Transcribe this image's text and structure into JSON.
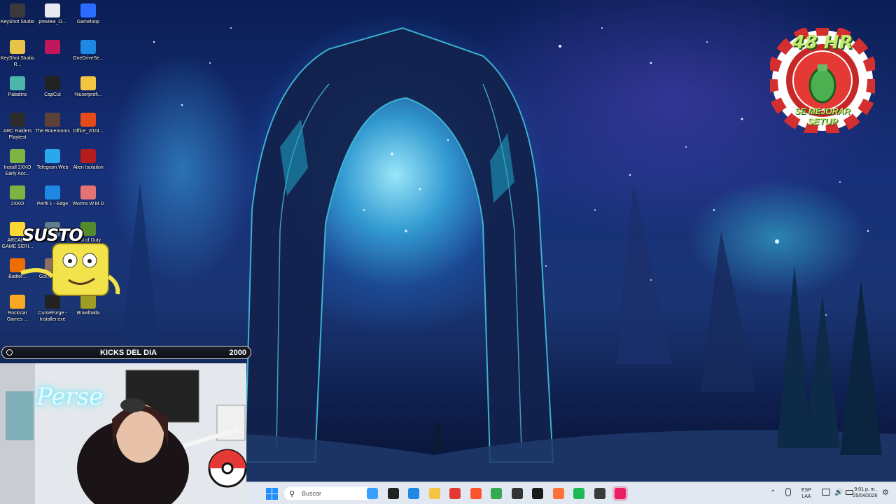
{
  "desktop": {
    "icons": [
      {
        "label": "KeyShot Studio",
        "color": "#3a3a3a"
      },
      {
        "label": "preview_O...",
        "color": "#e8e8f0"
      },
      {
        "label": "Gameloop",
        "color": "#2a6cff"
      },
      {
        "label": "KeyShot Studio R...",
        "color": "#e7c34a"
      },
      {
        "label": "",
        "color": "#c2185b"
      },
      {
        "label": "OneDriveSe...",
        "color": "#1e88e5"
      },
      {
        "label": "Paladins",
        "color": "#4db6ac"
      },
      {
        "label": "CapCut",
        "color": "#222222"
      },
      {
        "label": "%userprofi...",
        "color": "#f4c542"
      },
      {
        "label": "ARC Raiders Playtest",
        "color": "#2b2b2b"
      },
      {
        "label": "The Bonerooms",
        "color": "#5d4037"
      },
      {
        "label": "Office_2024...",
        "color": "#e64a19"
      },
      {
        "label": "Install 2XKO Early Acc...",
        "color": "#7cb342"
      },
      {
        "label": "Telegram Web",
        "color": "#29a9eb"
      },
      {
        "label": "Alien Isolation",
        "color": "#b71c1c"
      },
      {
        "label": "2XKO",
        "color": "#7cb342"
      },
      {
        "label": "Perfil 1 - Edge",
        "color": "#1e88e5"
      },
      {
        "label": "Worms W.M.D",
        "color": "#e57373"
      },
      {
        "label": "ARCADE GAME SERI...",
        "color": "#fdd835"
      },
      {
        "label": "Auto",
        "color": "#607d8b"
      },
      {
        "label": "Call of Duty",
        "color": "#558b2f"
      },
      {
        "label": "Battlef...",
        "color": "#ef6c00"
      },
      {
        "label": "Goi... Your...",
        "color": "#8d6e63"
      },
      {
        "label": "Adobe Illustrat...",
        "color": "#3b1f00"
      },
      {
        "label": "Rockstar Games ...",
        "color": "#f9a825"
      },
      {
        "label": "CurseForge - Installer.exe",
        "color": "#222222"
      },
      {
        "label": "Brawlhalla",
        "color": "#9e9d24"
      }
    ]
  },
  "overlays": {
    "badge_top": "48 HR",
    "badge_bottom_1": "SE MEJORAR",
    "badge_bottom_2": "SETUP",
    "badge_color": "#d32f2f",
    "susto_text": "SUSTO",
    "kicks_label": "KICKS DEL DIA",
    "kicks_count": "2000",
    "webcam_neon_text": "Perse"
  },
  "taskbar": {
    "search_placeholder": "Buscar",
    "pinned": [
      {
        "icon": "widgets-icon",
        "color": "#3aa0ff"
      },
      {
        "icon": "terminal-icon",
        "color": "#222222"
      },
      {
        "icon": "edge-icon",
        "color": "#1e88e5"
      },
      {
        "icon": "file-explorer-icon",
        "color": "#f4c542"
      },
      {
        "icon": "opera-icon",
        "color": "#e53935"
      },
      {
        "icon": "brave-icon",
        "color": "#fb542b"
      },
      {
        "icon": "chrome-icon",
        "color": "#34a853"
      },
      {
        "icon": "unity-icon",
        "color": "#333333"
      },
      {
        "icon": "epic-games-icon",
        "color": "#1a1a1a"
      },
      {
        "icon": "firefox-icon",
        "color": "#ff7139"
      },
      {
        "icon": "spotify-icon",
        "color": "#1db954"
      },
      {
        "icon": "obs-icon",
        "color": "#3a3a3a"
      },
      {
        "icon": "tiktok-icon",
        "color": "#e91e63"
      }
    ],
    "tray": {
      "lang_1": "ESP",
      "lang_2": "LAA",
      "time": "9:01 p. m.",
      "date": "25/04/2026"
    }
  }
}
